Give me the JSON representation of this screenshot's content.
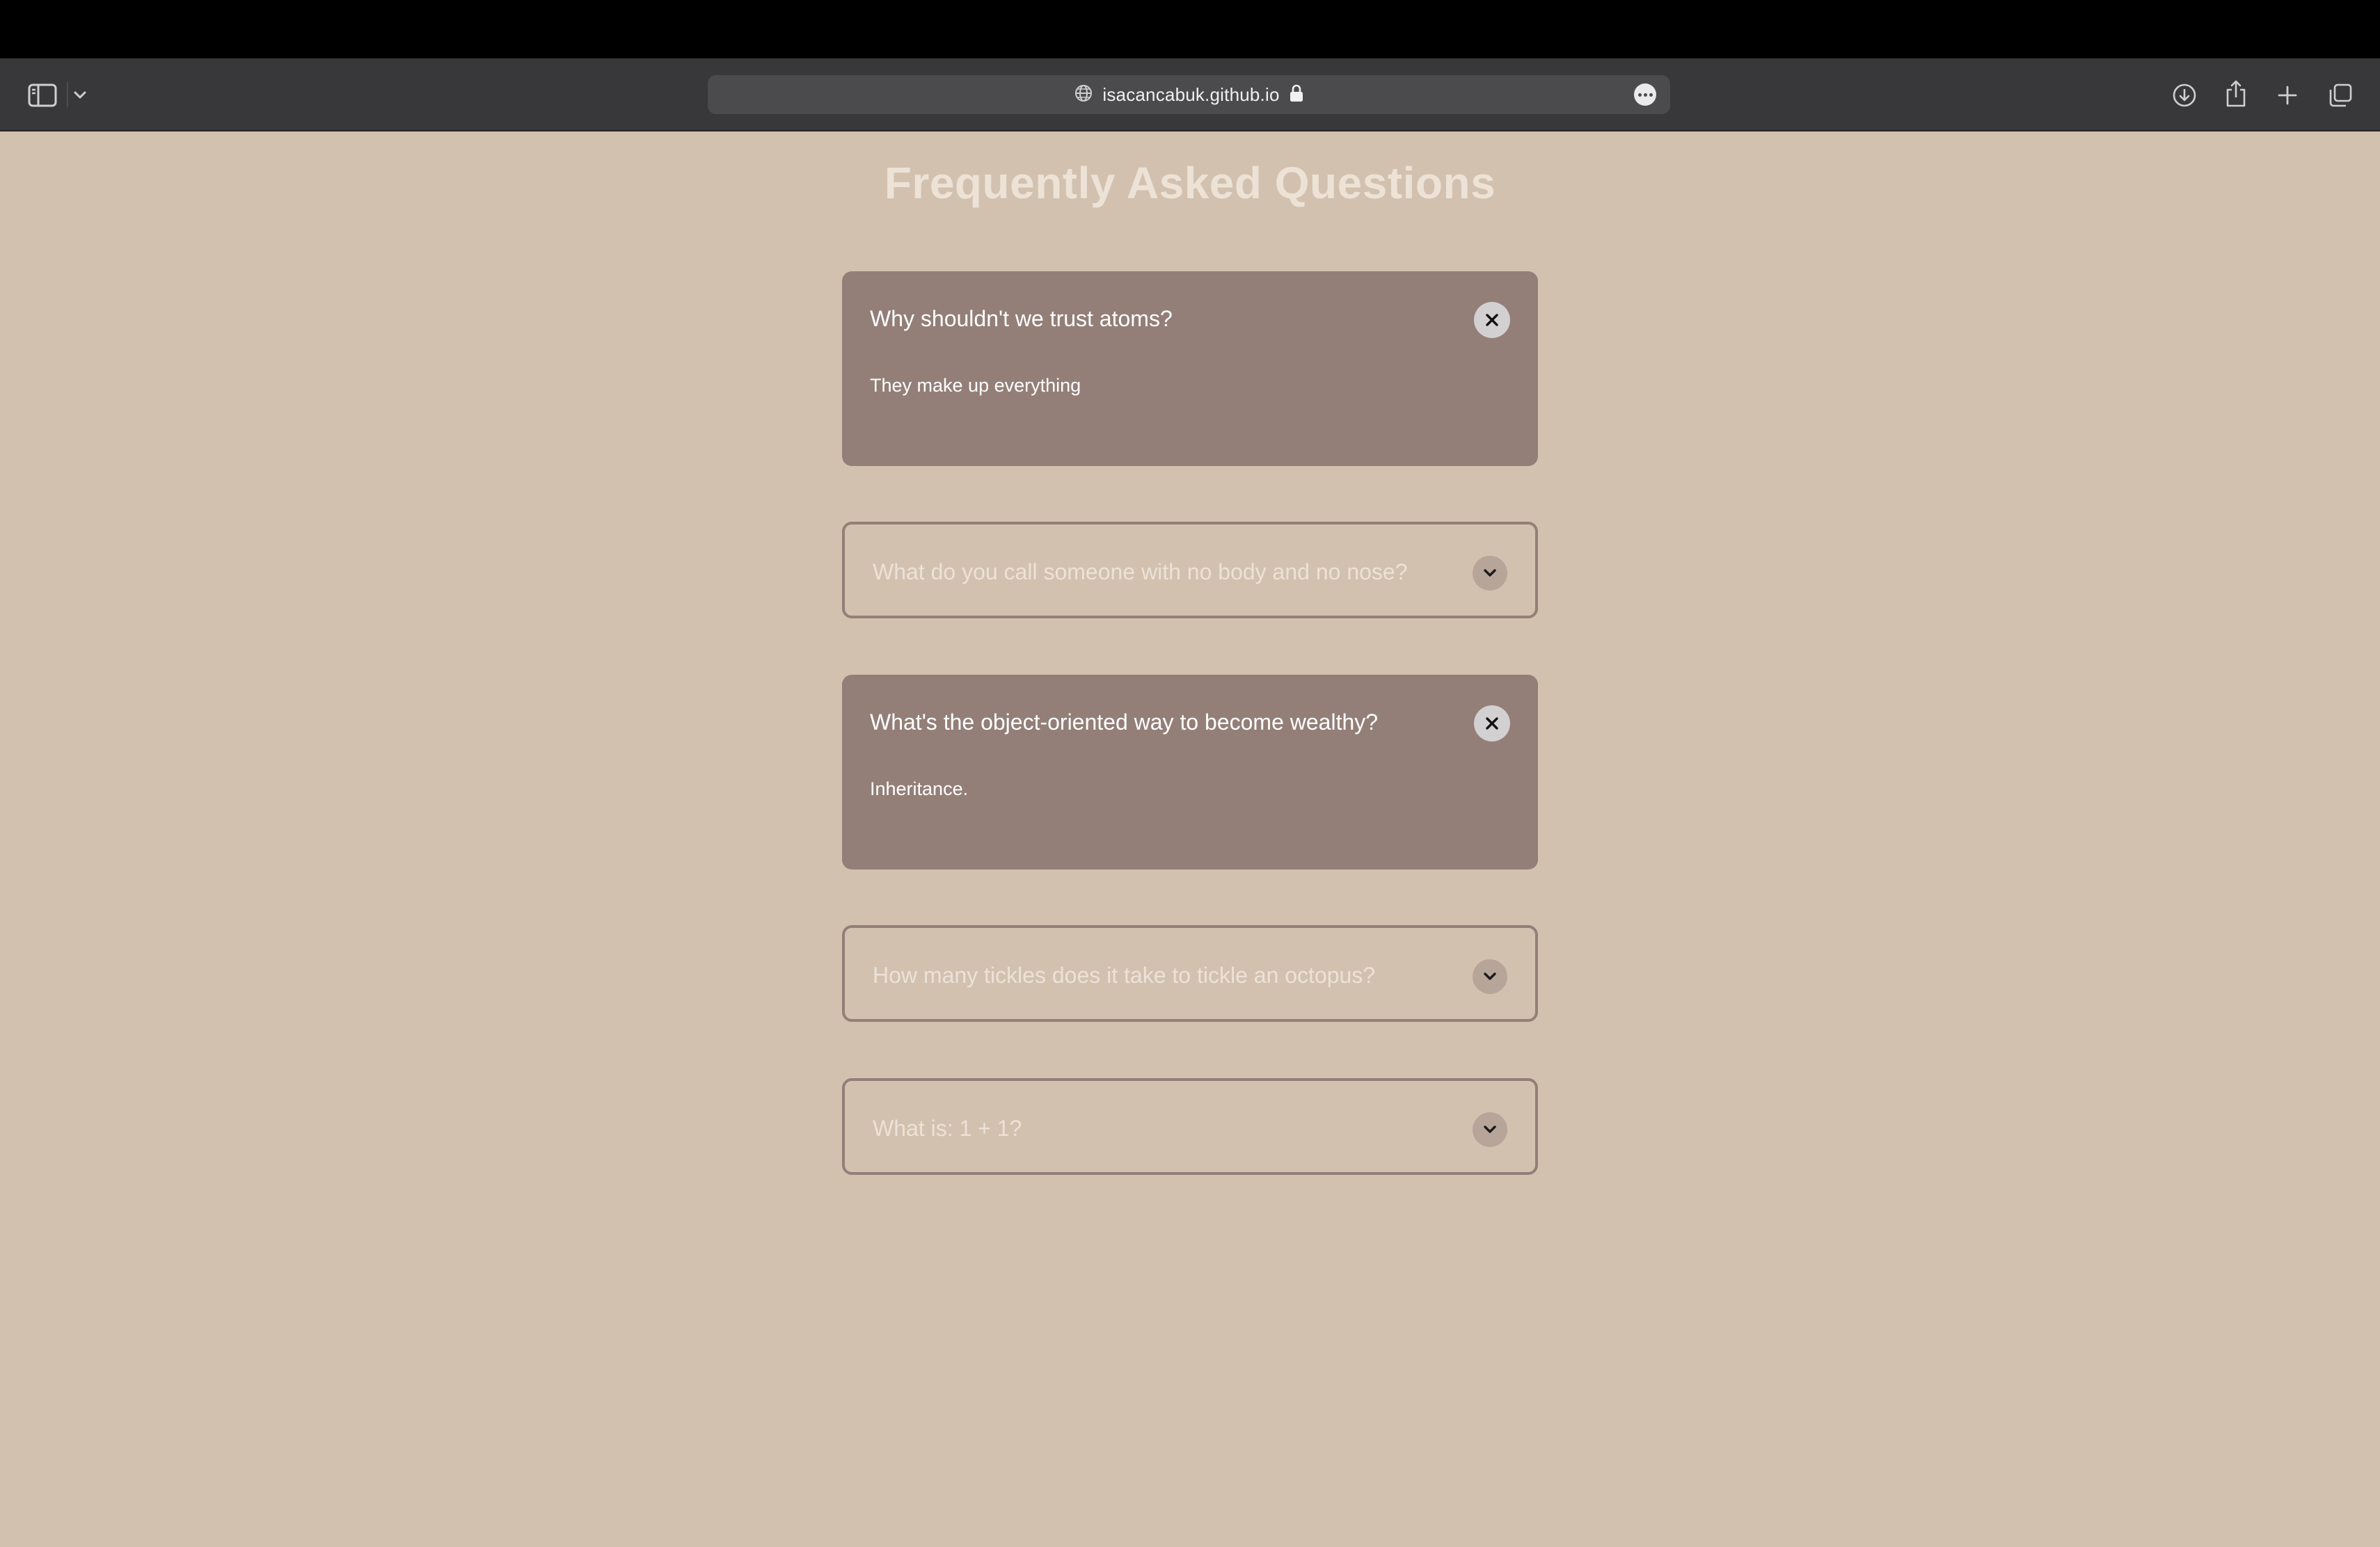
{
  "browser": {
    "url": "isacancabuk.github.io",
    "icons": {
      "sidebar": "sidebar-toggle-icon",
      "chevron": "chevron-down-icon",
      "globe": "globe-icon",
      "lock": "lock-icon",
      "more": "more-icon",
      "download": "download-icon",
      "share": "share-icon",
      "new_tab": "plus-icon",
      "tab_overview": "tabs-icon"
    }
  },
  "page": {
    "title": "Frequently Asked Questions",
    "colors": {
      "background": "#d3c1b0",
      "card": "#937f78",
      "title": "#ede2d6"
    },
    "faqs": [
      {
        "question": "Why shouldn't we trust atoms?",
        "answer": "They make up everything",
        "expanded": true
      },
      {
        "question": "What do you call someone with no body and no nose?",
        "expanded": false
      },
      {
        "question": "What's the object-oriented way to become wealthy?",
        "answer": "Inheritance.",
        "expanded": true
      },
      {
        "question": "How many tickles does it take to tickle an octopus?",
        "expanded": false
      },
      {
        "question": "What is: 1 + 1?",
        "expanded": false
      }
    ]
  }
}
